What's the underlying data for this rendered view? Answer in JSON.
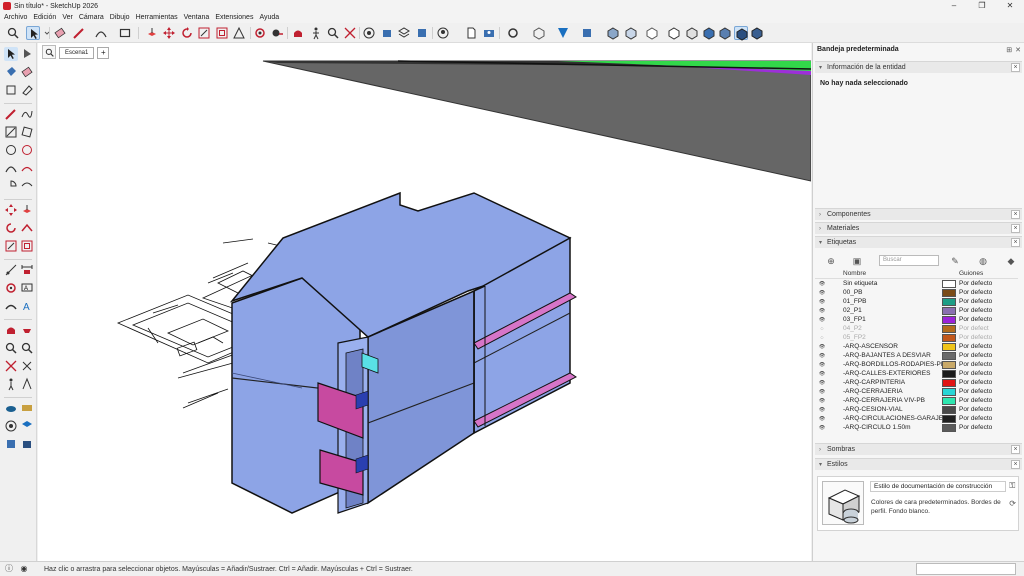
{
  "window": {
    "title": "Sin título* - SketchUp 2026",
    "minimize": "–",
    "maximize": "❐",
    "close": "✕"
  },
  "menu": [
    "Archivo",
    "Edición",
    "Ver",
    "Cámara",
    "Dibujo",
    "Herramientas",
    "Ventana",
    "Extensiones",
    "Ayuda"
  ],
  "scene": {
    "tab": "Escena1",
    "add": "+"
  },
  "tray": {
    "title": "Bandeja predeterminada",
    "entity_info": {
      "label": "Información de la entidad",
      "message": "No hay nada seleccionado"
    },
    "components": "Componentes",
    "materials": "Materiales",
    "tags": {
      "label": "Etiquetas",
      "search_placeholder": "Buscar",
      "col_name": "Nombre",
      "col_dashes": "Guiones",
      "rows": [
        {
          "name": "Sin etiqueta",
          "color": "#ffffff",
          "dash": "Por defecto",
          "dim": false
        },
        {
          "name": "00_PB",
          "color": "#7a4b17",
          "dash": "Por defecto",
          "dim": false
        },
        {
          "name": "01_FPB",
          "color": "#1e9e86",
          "dash": "Por defecto",
          "dim": false
        },
        {
          "name": "02_P1",
          "color": "#8a6fb0",
          "dash": "Por defecto",
          "dim": false
        },
        {
          "name": "03_FP1",
          "color": "#9a22d8",
          "dash": "Por defecto",
          "dim": false
        },
        {
          "name": "04_P2",
          "color": "#b36b1c",
          "dash": "Por defect",
          "dim": true
        },
        {
          "name": "05_FP2",
          "color": "#c2571a",
          "dash": "Por defecto",
          "dim": true
        },
        {
          "name": "-ARQ-ASCENSOR",
          "color": "#f0c419",
          "dash": "Por defecto",
          "dim": false
        },
        {
          "name": "-ARQ-BAJANTES A DESVIAR",
          "color": "#6a6a6a",
          "dash": "Por defecto",
          "dim": false
        },
        {
          "name": "-ARQ-BORDILLOS-RODAPIES-PR...",
          "color": "#c9a968",
          "dash": "Por defecto",
          "dim": false
        },
        {
          "name": "-ARQ-CALLES-EXTERIORES",
          "color": "#1a1a1a",
          "dash": "Por defecto",
          "dim": false
        },
        {
          "name": "-ARQ-CARPINTERIA",
          "color": "#e01414",
          "dash": "Por defecto",
          "dim": false
        },
        {
          "name": "-ARQ-CERRAJERIA",
          "color": "#28d6d6",
          "dash": "Por defecto",
          "dim": false
        },
        {
          "name": "-ARQ-CERRAJERIA VIV-PB",
          "color": "#2ee6b0",
          "dash": "Por defecto",
          "dim": false
        },
        {
          "name": "-ARQ-CESION-VIAL",
          "color": "#4a4a4a",
          "dash": "Por defecto",
          "dim": false
        },
        {
          "name": "-ARQ-CIRCULACIONES-GARAJE",
          "color": "#202020",
          "dash": "Por defecto",
          "dim": false
        },
        {
          "name": "-ARQ-CIRCULO 1.50m",
          "color": "#5a5a5a",
          "dash": "Por defecto",
          "dim": false
        }
      ]
    },
    "shadows": "Sombras",
    "styles": {
      "label": "Estilos",
      "name": "Estilo de documentación de construcción",
      "description": "Colores de cara predeterminados. Bordes de perfil. Fondo blanco."
    }
  },
  "status": {
    "hint": "Haz clic o arrastra para seleccionar objetos. Mayúsculas = Añadir/Sustraer. Ctrl = Añadir. Mayúsculas + Ctrl = Sustraer."
  }
}
